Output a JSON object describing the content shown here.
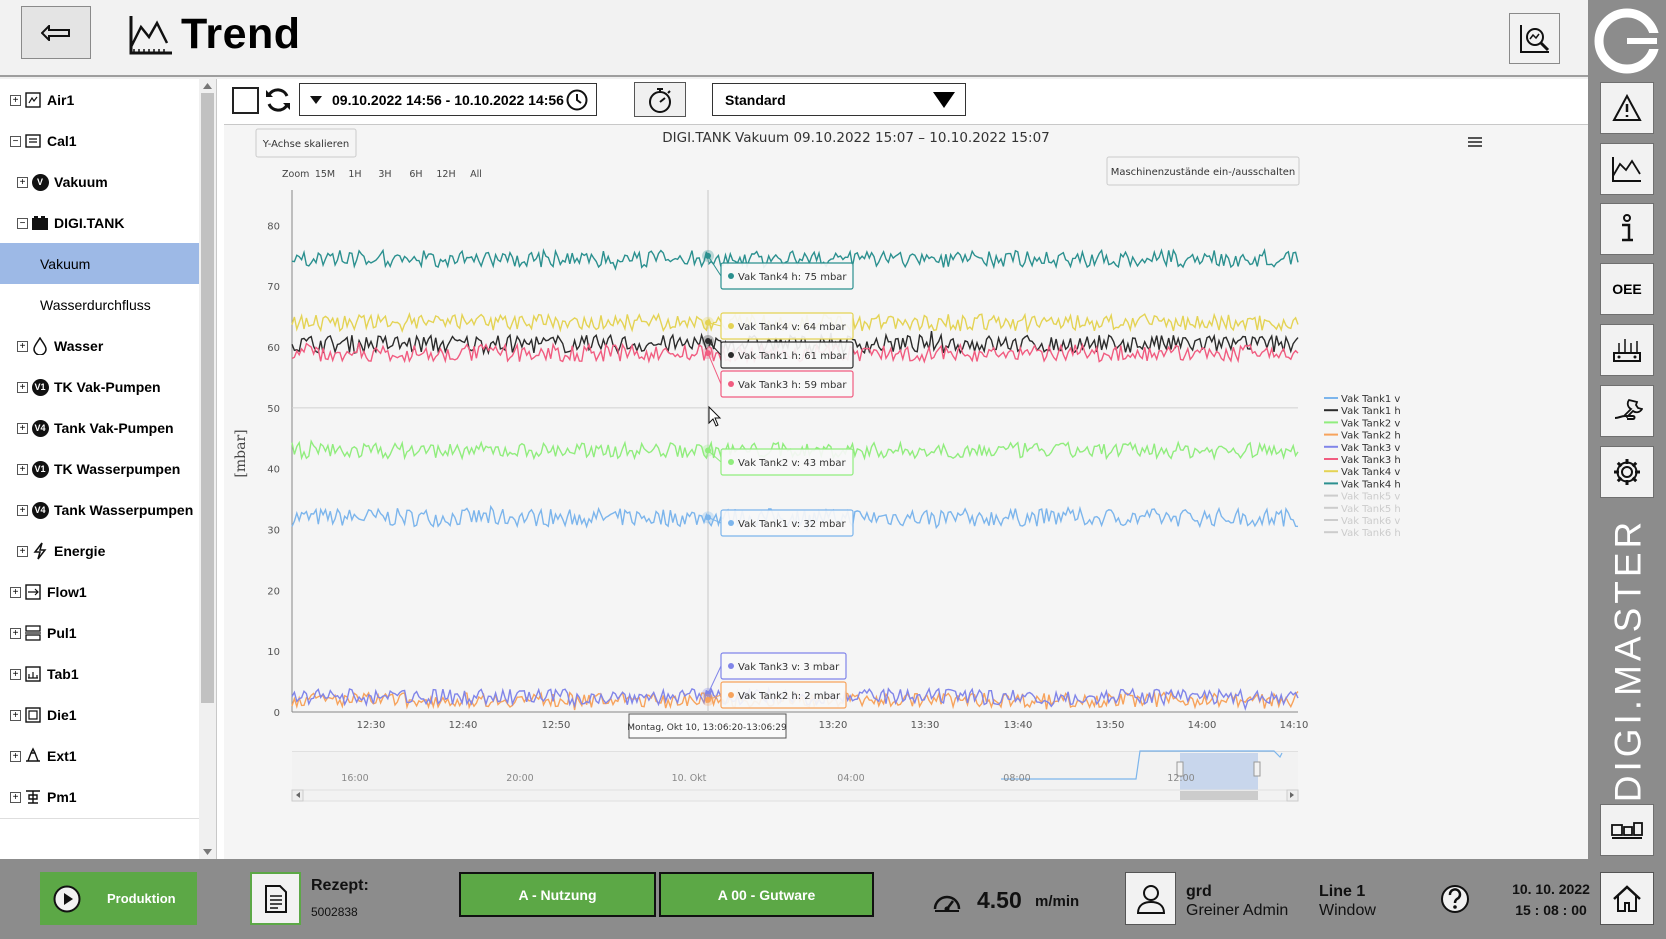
{
  "header": {
    "title": "Trend"
  },
  "sidebar": {
    "items": [
      {
        "label": "Air1",
        "exp": "+",
        "level": 0,
        "icon": "air-machine-icon"
      },
      {
        "label": "Cal1",
        "exp": "−",
        "level": 0,
        "icon": "calibrator-icon"
      },
      {
        "label": "Vakuum",
        "exp": "+",
        "level": 1,
        "icon": "badge-v-icon",
        "badge": "V"
      },
      {
        "label": "DIGI.TANK",
        "exp": "−",
        "level": 1,
        "icon": "tank-icon"
      },
      {
        "label": "Vakuum",
        "exp": "",
        "level": 2,
        "selected": true
      },
      {
        "label": "Wasserdurchfluss",
        "exp": "",
        "level": 2
      },
      {
        "label": "Wasser",
        "exp": "+",
        "level": 1,
        "icon": "water-drop-icon"
      },
      {
        "label": "TK Vak-Pumpen",
        "exp": "+",
        "level": 1,
        "icon": "badge-v1-icon",
        "badge": "V1"
      },
      {
        "label": "Tank Vak-Pumpen",
        "exp": "+",
        "level": 1,
        "icon": "badge-v4-icon",
        "badge": "V4"
      },
      {
        "label": "TK Wasserpumpen",
        "exp": "+",
        "level": 1,
        "icon": "badge-v1-icon",
        "badge": "V1"
      },
      {
        "label": "Tank Wasserpumpen",
        "exp": "+",
        "level": 1,
        "icon": "badge-v4-icon",
        "badge": "V4"
      },
      {
        "label": "Energie",
        "exp": "+",
        "level": 1,
        "icon": "lightning-icon"
      },
      {
        "label": "Flow1",
        "exp": "+",
        "level": 0,
        "icon": "flow-icon"
      },
      {
        "label": "Pul1",
        "exp": "+",
        "level": 0,
        "icon": "puller-icon"
      },
      {
        "label": "Tab1",
        "exp": "+",
        "level": 0,
        "icon": "table-machine-icon"
      },
      {
        "label": "Die1",
        "exp": "+",
        "level": 0,
        "icon": "die-icon"
      },
      {
        "label": "Ext1",
        "exp": "+",
        "level": 0,
        "icon": "extruder-icon"
      },
      {
        "label": "Pm1",
        "exp": "+",
        "level": 0,
        "icon": "pm-machine-icon"
      }
    ]
  },
  "toolbar": {
    "date_range": "09.10.2022 14:56 - 10.10.2022 14:56",
    "view_select": "Standard"
  },
  "chart_controls": {
    "y_scale_button": "Y-Achse skalieren",
    "machine_states_button": "Maschinenzustände ein-/ausschalten",
    "zoom_label": "Zoom",
    "zoom_options": [
      "15M",
      "1H",
      "3H",
      "6H",
      "12H",
      "All"
    ]
  },
  "chart_data": {
    "type": "line",
    "title": "DIGI.TANK Vakuum 09.10.2022 15:07 – 10.10.2022 15:07",
    "ylabel": "[mbar]",
    "xlabel": "",
    "ylim": [
      0,
      85
    ],
    "yticks": [
      0,
      10,
      20,
      30,
      40,
      50,
      60,
      70,
      80
    ],
    "xticks": [
      "12:30",
      "12:40",
      "12:50",
      "13:20",
      "13:30",
      "13:40",
      "13:50",
      "14:00",
      "14:10"
    ],
    "grid": "horizontal line at 50",
    "legend_position": "right",
    "series": [
      {
        "name": "Vak Tank1 v",
        "color": "#7cb5ec",
        "mean": 32,
        "noise": 1.5,
        "visible": true
      },
      {
        "name": "Vak Tank1 h",
        "color": "#2b2b2b",
        "mean": 60.5,
        "noise": 1.5,
        "visible": true
      },
      {
        "name": "Vak Tank2 v",
        "color": "#90ed7d",
        "mean": 43,
        "noise": 1.3,
        "visible": true
      },
      {
        "name": "Vak Tank2 h",
        "color": "#f7a35c",
        "mean": 2,
        "noise": 1.2,
        "visible": true
      },
      {
        "name": "Vak Tank3 v",
        "color": "#8085e9",
        "mean": 2.5,
        "noise": 1.3,
        "visible": true
      },
      {
        "name": "Vak Tank3 h",
        "color": "#f15c80",
        "mean": 59,
        "noise": 1.4,
        "visible": true
      },
      {
        "name": "Vak Tank4 v",
        "color": "#e4d354",
        "mean": 64,
        "noise": 1.4,
        "visible": true
      },
      {
        "name": "Vak Tank4 h",
        "color": "#2b908f",
        "mean": 74.5,
        "noise": 1.4,
        "visible": true
      },
      {
        "name": "Vak Tank5 v",
        "color": "#cccccc",
        "visible": false
      },
      {
        "name": "Vak Tank5 h",
        "color": "#cccccc",
        "visible": false
      },
      {
        "name": "Vak Tank6 v",
        "color": "#cccccc",
        "visible": false
      },
      {
        "name": "Vak Tank6 h",
        "color": "#cccccc",
        "visible": false
      }
    ],
    "tooltips": [
      {
        "text": "Vak Tank4 h: 75 mbar",
        "color": "#2b908f",
        "value": 75
      },
      {
        "text": "Vak Tank4 v: 64 mbar",
        "color": "#e4d354",
        "value": 64
      },
      {
        "text": "Vak Tank1 h: 61 mbar",
        "color": "#2b2b2b",
        "value": 61
      },
      {
        "text": "Vak Tank3 h: 59 mbar",
        "color": "#f15c80",
        "value": 59
      },
      {
        "text": "Vak Tank2 v: 43 mbar",
        "color": "#90ed7d",
        "value": 43
      },
      {
        "text": "Vak Tank1 v: 32 mbar",
        "color": "#7cb5ec",
        "value": 32
      },
      {
        "text": "Vak Tank3 v: 3 mbar",
        "color": "#8085e9",
        "value": 3
      },
      {
        "text": "Vak Tank2 h: 2 mbar",
        "color": "#f7a35c",
        "value": 2
      }
    ],
    "crosshair_label": "Montag, Okt 10, 13:06:20-13:06:29",
    "navigator_ticks": [
      "16:00",
      "20:00",
      "10. Okt",
      "04:00",
      "08:00",
      "12:00"
    ]
  },
  "bottom": {
    "production_label": "Produktion",
    "rezept_label": "Rezept:",
    "rezept_value": "5002838",
    "status1": "A - Nutzung",
    "status2": "A 00 - Gutware",
    "speed_value": "4.50",
    "speed_unit": "m/min",
    "user_name": "grd",
    "user_role": "Greiner Admin",
    "line_name": "Line 1",
    "line_window": "Window",
    "date": "10. 10. 2022",
    "time": "15 : 08 : 00"
  },
  "rightbar": {
    "brand": "DIGI.MASTER",
    "oee_label": "OEE"
  },
  "colors": {
    "accent_green": "#5ca846",
    "selected": "#9db9e6",
    "bar_gray": "#8c8c8c"
  }
}
